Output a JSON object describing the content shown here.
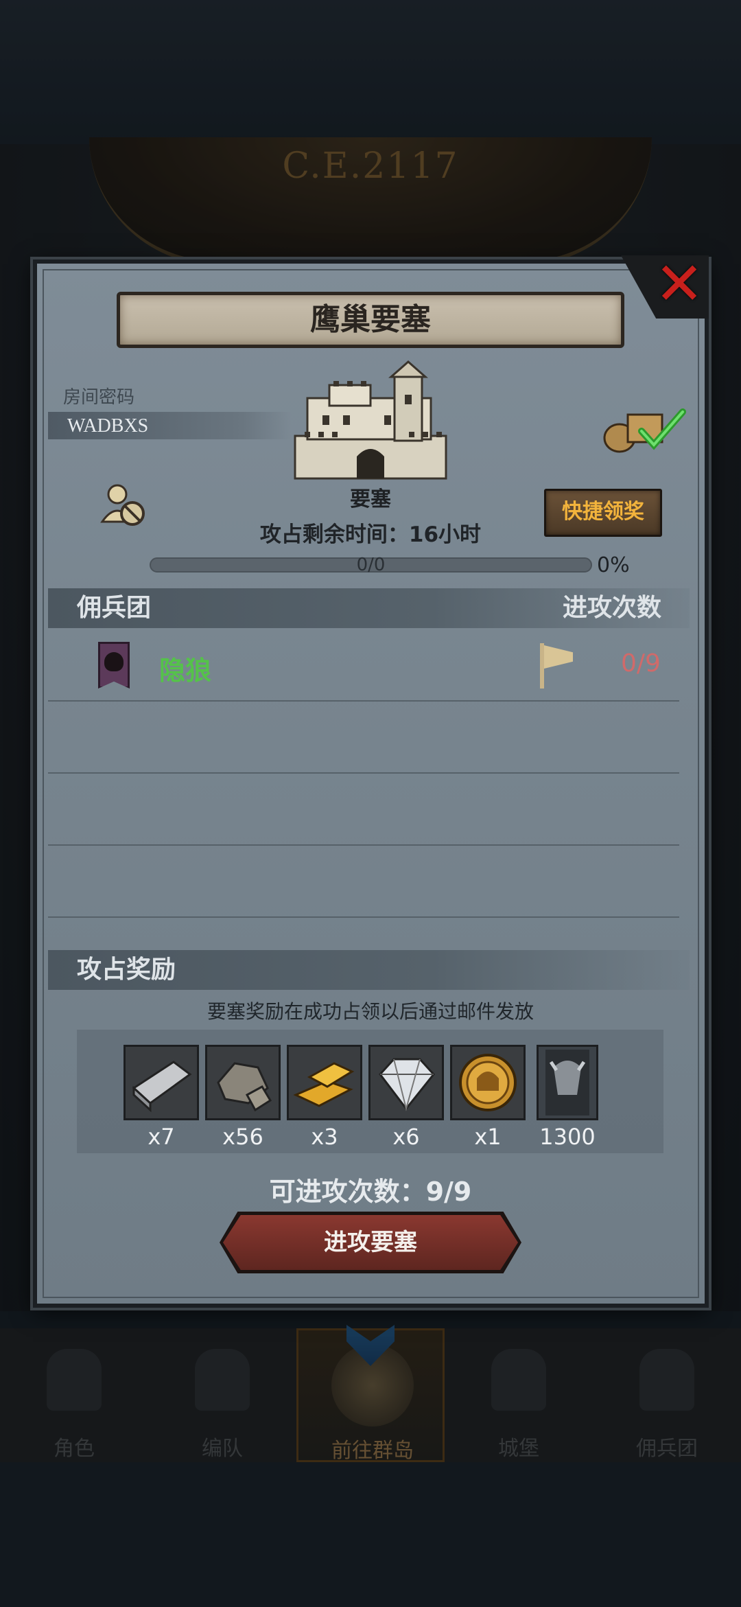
{
  "background": {
    "era": "C.E.2117",
    "nav": [
      {
        "label": "角色",
        "icon": "knight-icon"
      },
      {
        "label": "编队",
        "icon": "helmet-icon"
      },
      {
        "label": "前往群岛",
        "icon": "compass-icon"
      },
      {
        "label": "城堡",
        "icon": "castle-icon"
      },
      {
        "label": "佣兵团",
        "icon": "mercenary-icon"
      }
    ]
  },
  "modal": {
    "title": "鹰巢要塞",
    "room_password_label": "房间密码",
    "room_code": "WADBXS",
    "fortress_label": "要塞",
    "quick_claim_label": "快捷领奖",
    "time_remaining": "攻占剩余时间：16小时",
    "progress": {
      "text": "0/0",
      "percent_text": "0%",
      "fraction": 0
    },
    "mercenary_header": "佣兵团",
    "attack_count_header": "进攻次数",
    "guilds": [
      {
        "name": "隐狼",
        "attack_count": "0/9"
      }
    ],
    "reward_header": "攻占奖励",
    "reward_note": "要塞奖励在成功占领以后通过邮件发放",
    "rewards": [
      {
        "icon": "iron-ingot-icon",
        "qty": "x7"
      },
      {
        "icon": "stone-ore-icon",
        "qty": "x56"
      },
      {
        "icon": "gold-bars-icon",
        "qty": "x3"
      },
      {
        "icon": "diamond-icon",
        "qty": "x6"
      },
      {
        "icon": "helmet-coin-icon",
        "qty": "x1"
      },
      {
        "icon": "minotaur-banner-icon",
        "qty": "1300"
      }
    ],
    "attacks_available": "可进攻次数：9/9",
    "attack_button": "进攻要塞"
  }
}
